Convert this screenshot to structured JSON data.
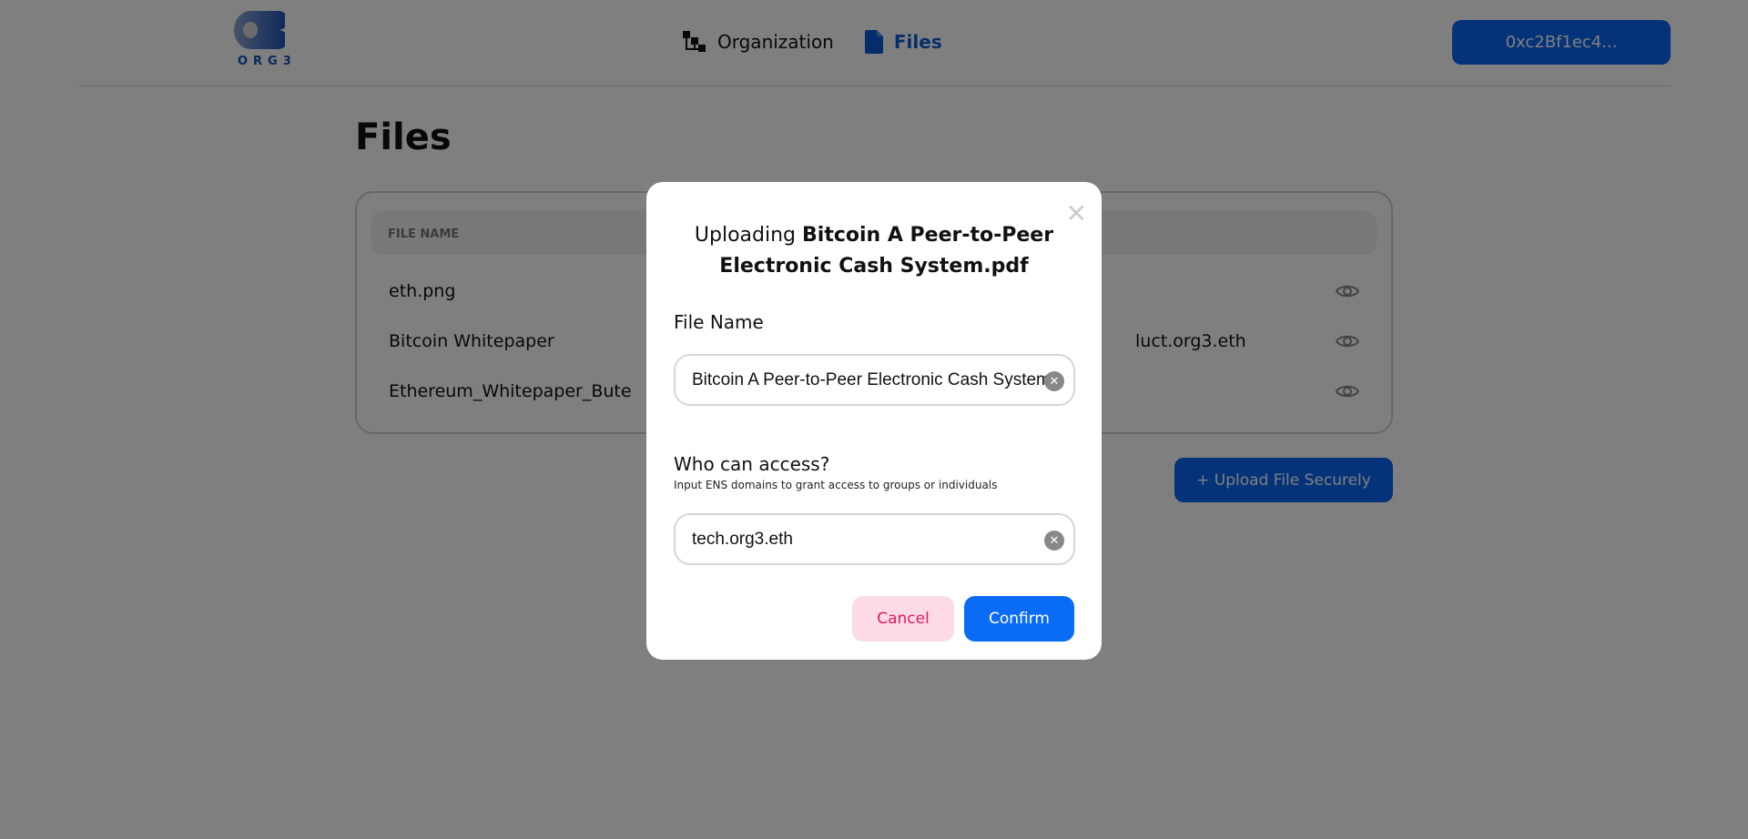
{
  "header": {
    "logo_text": "ORG3",
    "nav": [
      {
        "label": "Organization",
        "icon": "hierarchy-icon"
      },
      {
        "label": "Files",
        "icon": "file-icon",
        "active": true
      }
    ],
    "wallet": "0xc2Bf1ec4..."
  },
  "page": {
    "title": "Files",
    "table": {
      "columns": [
        "FILE NAME"
      ],
      "rows": [
        {
          "name": "eth.png",
          "access": ""
        },
        {
          "name": "Bitcoin Whitepaper",
          "access": "luct.org3.eth"
        },
        {
          "name": "Ethereum_Whitepaper_Bute",
          "access": ""
        }
      ]
    },
    "upload_label": "+ Upload File Securely"
  },
  "modal": {
    "title_prefix": "Uploading",
    "title_file": "Bitcoin A Peer-to-Peer Electronic Cash System.pdf",
    "file_name_label": "File Name",
    "file_name_value": "Bitcoin A Peer-to-Peer Electronic Cash System",
    "access_label": "Who can access?",
    "access_hint": "Input ENS domains to grant access to groups or individuals",
    "access_value": "tech.org3.eth",
    "cancel": "Cancel",
    "confirm": "Confirm"
  },
  "colors": {
    "primary": "#0a66f2",
    "cancel_bg": "#fddbe5",
    "cancel_text": "#e0195c"
  }
}
